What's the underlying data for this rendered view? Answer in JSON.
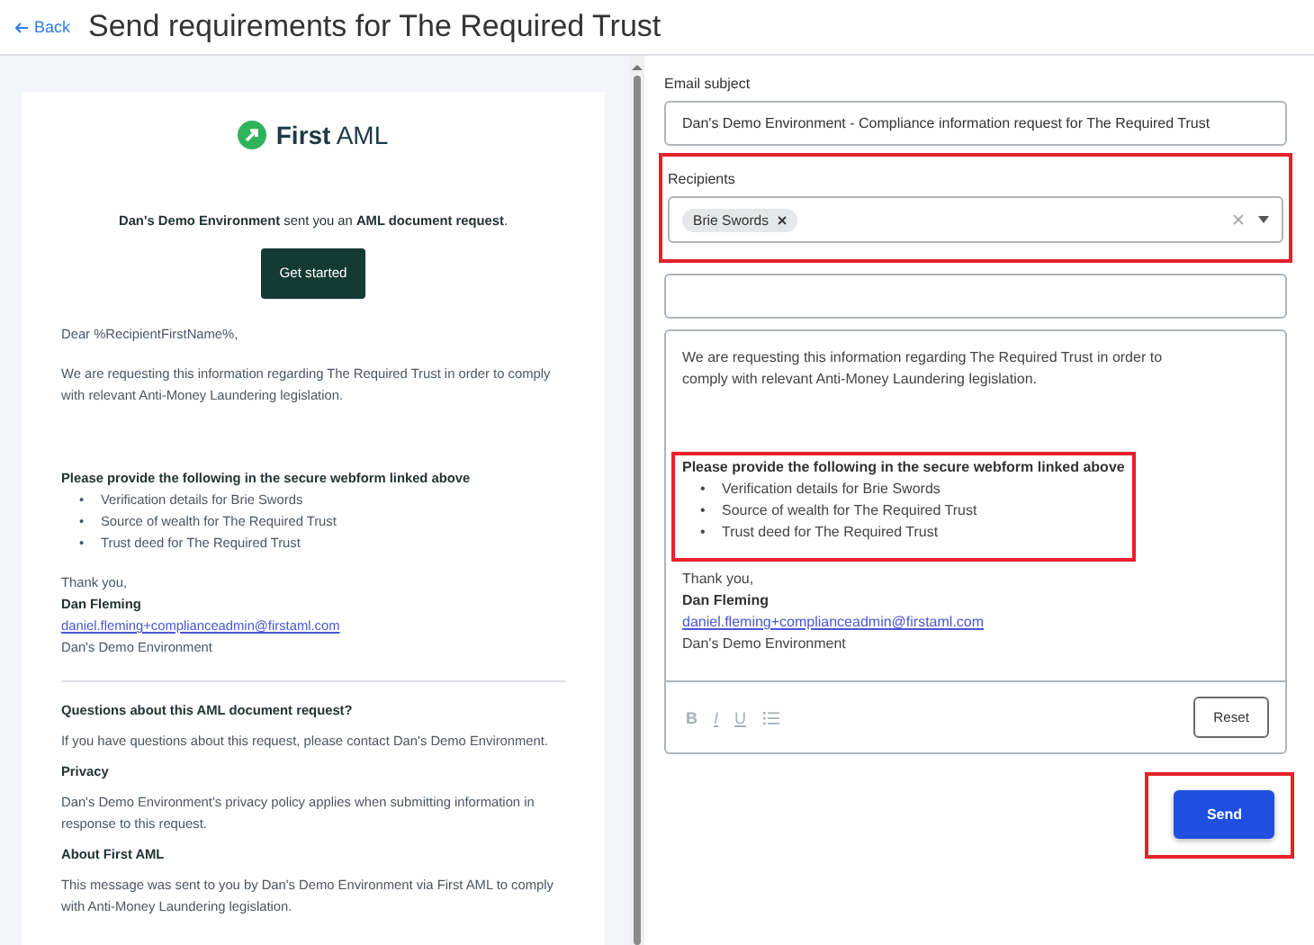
{
  "header": {
    "back": "Back",
    "title": "Send requirements for The Required Trust"
  },
  "preview": {
    "logo_text": "**First** AML",
    "intro": "**Dan's Demo Environment** sent you an **AML document request**.",
    "cta": "Get started",
    "greeting": "Dear %RecipientFirstName%,",
    "paragraph": "We are requesting this information regarding The Required Trust in order to comply with relevant Anti-Money Laundering legislation.",
    "requirements": {
      "heading": "Please provide the following in the secure webform linked above",
      "items": [
        {
          "marker": "•",
          "text": "Verification details for Brie Swords"
        },
        {
          "marker": "•",
          "text": "Source of wealth for The Required Trust"
        },
        {
          "marker": "•",
          "text": "Trust deed for The Required Trust"
        }
      ]
    },
    "signoff": "Thank you,",
    "sender_name": "Dan Fleming",
    "sender_email": "daniel.fleming+complianceadmin@firstaml.com",
    "sender_org": "Dan's Demo Environment",
    "footer_sections": [
      {
        "heading": "Questions about this AML document request?",
        "text": "If you have questions about this request, please contact Dan's Demo Environment."
      },
      {
        "heading": "Privacy",
        "text": "Dan's Demo Environment's privacy policy applies when submitting information in response to this request."
      },
      {
        "heading": "About First AML",
        "text": "This message was sent to you by Dan's Demo Environment via First AML to comply with Anti-Money Laundering legislation."
      }
    ]
  },
  "form": {
    "subject": {
      "label": "Email subject",
      "value": "Dan's Demo Environment - Compliance information request for The Required Trust"
    },
    "recipients": {
      "label": "Recipients",
      "highlighted": true,
      "chips": [
        "Brie Swords"
      ]
    },
    "body": {
      "paragraph": "We are requesting this information regarding The Required Trust in order to comply with relevant Anti-Money Laundering legislation.",
      "requirements": {
        "highlighted": true,
        "heading": "Please provide the following in the secure webform linked above",
        "items": [
          {
            "marker": "•",
            "text": "Verification details for Brie Swords"
          },
          {
            "marker": "•",
            "text": "Source of wealth for The Required Trust"
          },
          {
            "marker": "•",
            "text": "Trust deed for The Required Trust"
          }
        ]
      },
      "signoff": "Thank you,",
      "sender_name": "Dan Fleming",
      "sender_email": "daniel.fleming+complianceadmin@firstaml.com",
      "sender_org": "Dan's Demo Environment",
      "toolbar": [
        {
          "kind": "bold",
          "label": "B",
          "disabled": true
        },
        {
          "kind": "italic",
          "label": "I",
          "disabled": true
        },
        {
          "kind": "underline",
          "label": "U",
          "disabled": true
        },
        {
          "kind": "list",
          "disabled": true
        }
      ],
      "reset": "Reset"
    },
    "send": {
      "label": "Send",
      "highlighted": true
    }
  }
}
